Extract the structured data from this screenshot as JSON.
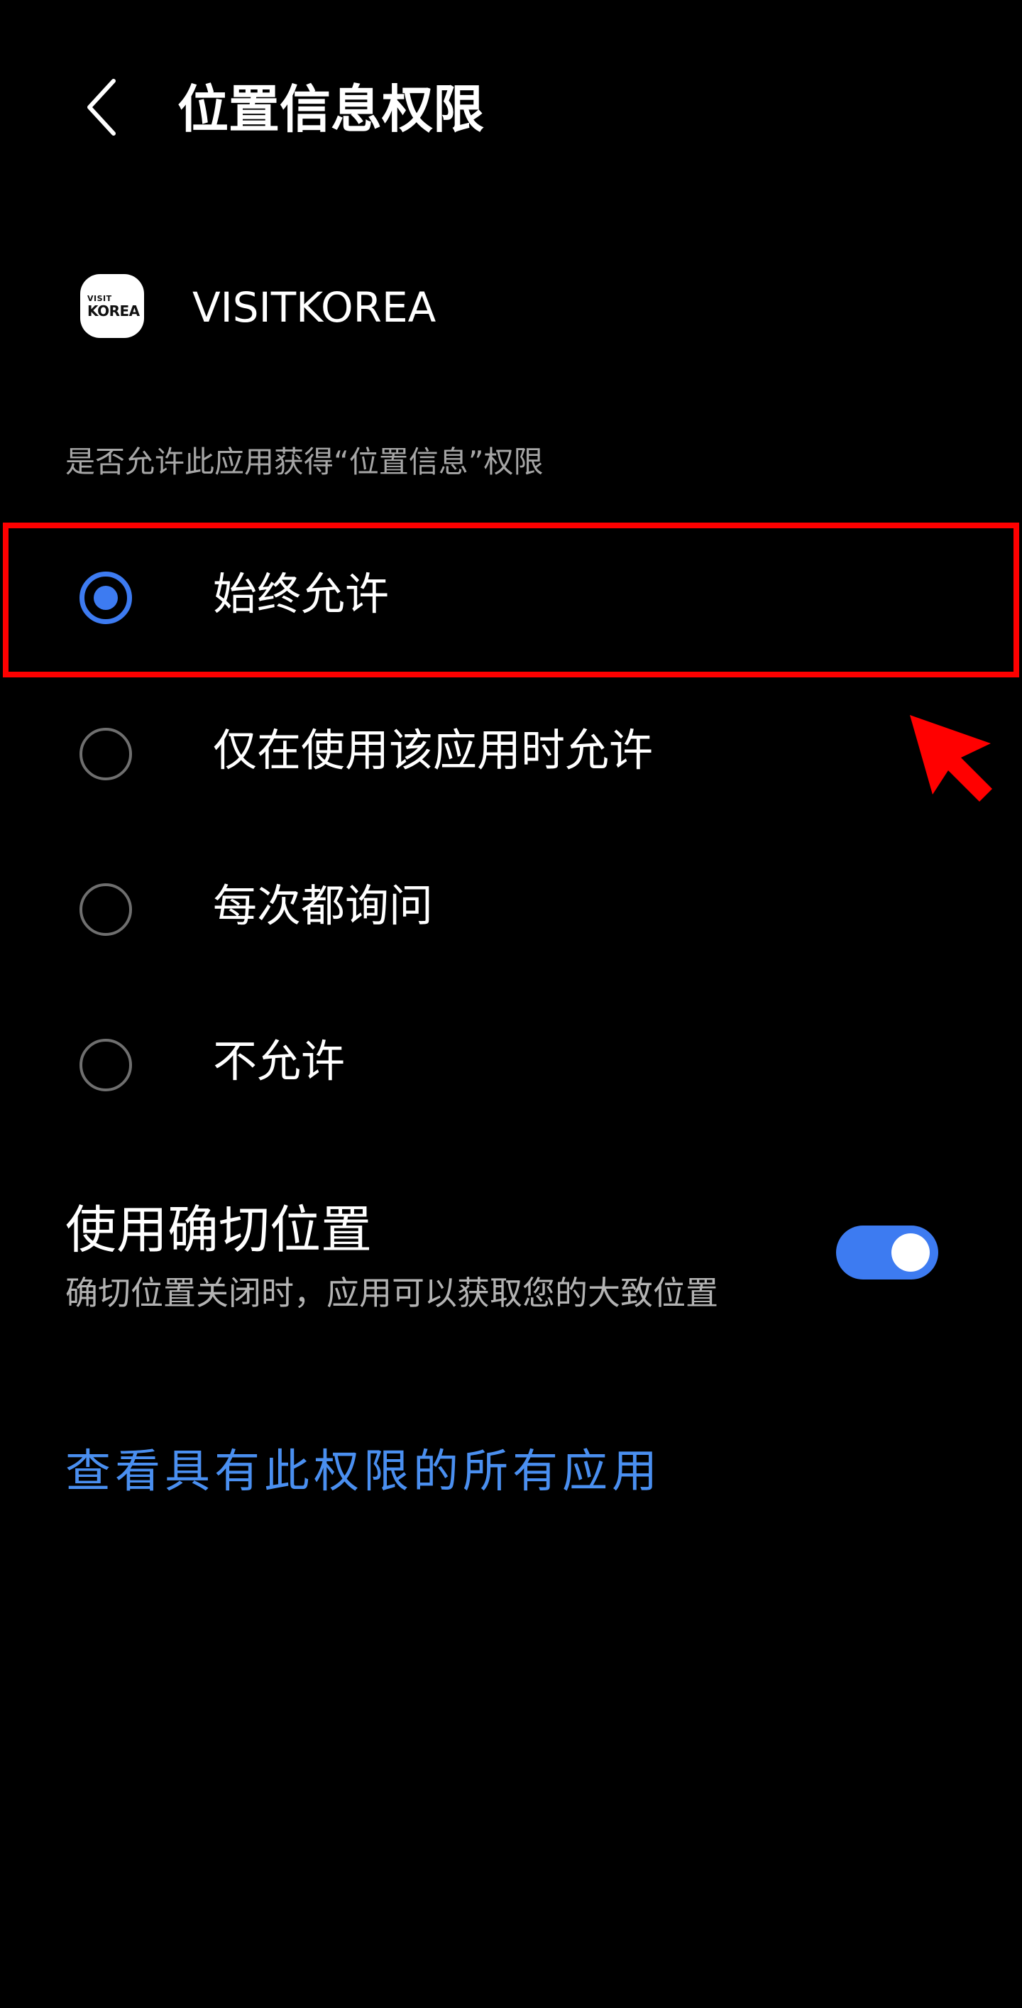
{
  "header": {
    "back_icon": "chevron-left-icon",
    "title": "位置信息权限"
  },
  "app": {
    "icon_line1": "VISIT",
    "icon_line2": "KOREA",
    "name": "VISITKOREA"
  },
  "question": "是否允许此应用获得“位置信息”权限",
  "options": [
    {
      "label": "始终允许",
      "checked": true
    },
    {
      "label": "仅在使用该应用时允许",
      "checked": false
    },
    {
      "label": "每次都询问",
      "checked": false
    },
    {
      "label": "不允许",
      "checked": false
    }
  ],
  "precise_location": {
    "title": "使用确切位置",
    "description": "确切位置关闭时，应用可以获取您的大致位置",
    "enabled": true
  },
  "link": {
    "label": "查看具有此权限的所有应用"
  },
  "colors": {
    "background": "#000000",
    "accent": "#3d7bf1",
    "link": "#4a8ff0",
    "highlight": "#ff0000"
  }
}
